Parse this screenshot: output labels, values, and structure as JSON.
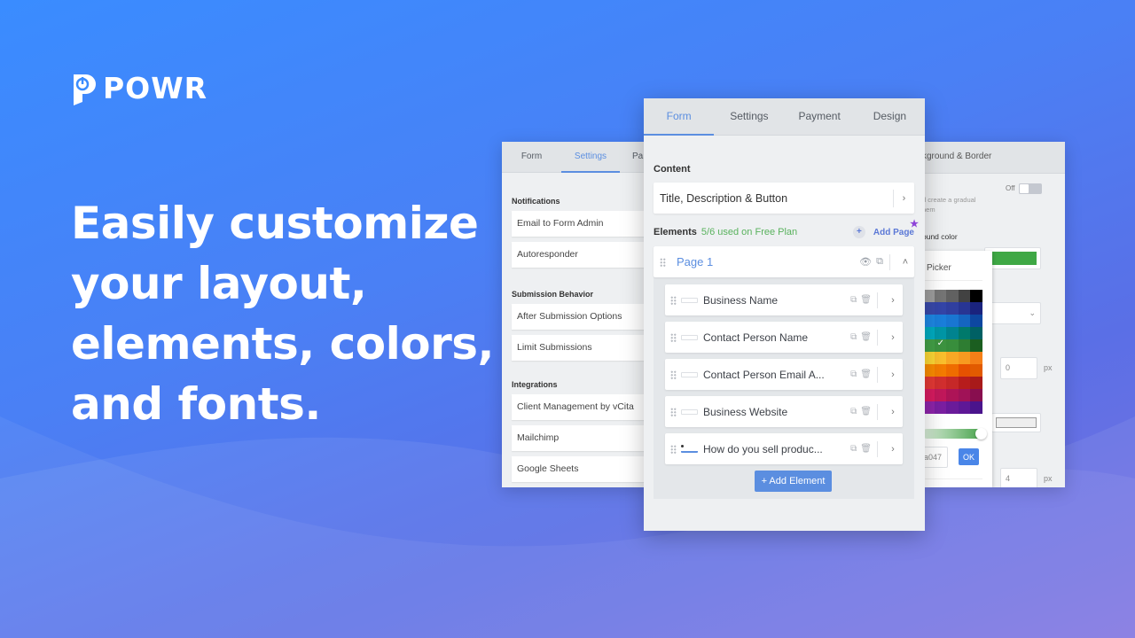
{
  "brand": {
    "name": "POWR"
  },
  "headline": [
    "Easily customize",
    "your layout,",
    "elements, colors,",
    "and fonts."
  ],
  "settings_panel": {
    "tabs": [
      {
        "label": "Form"
      },
      {
        "label": "Settings",
        "active": true
      },
      {
        "label": "Pa"
      }
    ],
    "sections": [
      {
        "title": "Notifications",
        "items": [
          "Email to Form Admin",
          "Autoresponder"
        ]
      },
      {
        "title": "Submission Behavior",
        "items": [
          "After Submission Options",
          "Limit Submissions"
        ]
      },
      {
        "title": "Integrations",
        "items": [
          "Client Management by vCita",
          "Mailchimp",
          "Google Sheets"
        ]
      }
    ]
  },
  "form_panel": {
    "tabs": [
      {
        "label": "Form",
        "active": true
      },
      {
        "label": "Settings"
      },
      {
        "label": "Payment"
      },
      {
        "label": "Design"
      }
    ],
    "content_label": "Content",
    "content_item": "Title, Description & Button",
    "elements_label": "Elements",
    "plan_usage": "5/6 used on Free Plan",
    "add_page_label": "Add Page",
    "page_title": "Page 1",
    "elements": [
      {
        "label": "Business Name",
        "icon": "text-field-icon"
      },
      {
        "label": "Contact Person Name",
        "icon": "text-field-icon"
      },
      {
        "label": "Contact Person Email A...",
        "icon": "email-field-icon"
      },
      {
        "label": "Business Website",
        "icon": "text-field-icon"
      },
      {
        "label": "How do you sell produc...",
        "icon": "list-field-icon"
      }
    ],
    "add_element_label": "+ Add Element"
  },
  "design_panel": {
    "tab_label": "kground & Border",
    "toggle_label": "Off",
    "gradient_hint": [
      "d create a gradual",
      "hem"
    ],
    "bg_color_label": "ound color",
    "bg_color_swatch": "#3fa845",
    "border_width_value": "0",
    "radius_value": "4",
    "unit": "px",
    "picker": {
      "title": "Picker",
      "hex_value": "a047",
      "ok_label": "OK",
      "colors": [
        [
          "#9e9e9e",
          "#757575",
          "#616161",
          "#424242",
          "#000000"
        ],
        [
          "#3949ab",
          "#3445a8",
          "#303f9f",
          "#283593",
          "#1a237e"
        ],
        [
          "#1e88e5",
          "#1a7fdc",
          "#1976d2",
          "#1565c0",
          "#0d47a1"
        ],
        [
          "#00acc1",
          "#0097a7",
          "#00838f",
          "#00796b",
          "#006064"
        ],
        [
          "#43a047",
          "#3d9440",
          "#388e3c",
          "#2e7d32",
          "#1b5e20"
        ],
        [
          "#fdd835",
          "#fbc02d",
          "#f9a825",
          "#f79a20",
          "#f57f17"
        ],
        [
          "#fb8c00",
          "#f57c00",
          "#ef6c00",
          "#e65100",
          "#e25a00"
        ],
        [
          "#e53935",
          "#d32f2f",
          "#c62828",
          "#b71c1c",
          "#a81a1a"
        ],
        [
          "#d81b60",
          "#c2185b",
          "#ad1457",
          "#a01257",
          "#880e4f"
        ],
        [
          "#8e24aa",
          "#7b1fa2",
          "#6a1b9a",
          "#5e1896",
          "#4a148c"
        ]
      ],
      "selected": [
        4,
        1
      ]
    }
  }
}
